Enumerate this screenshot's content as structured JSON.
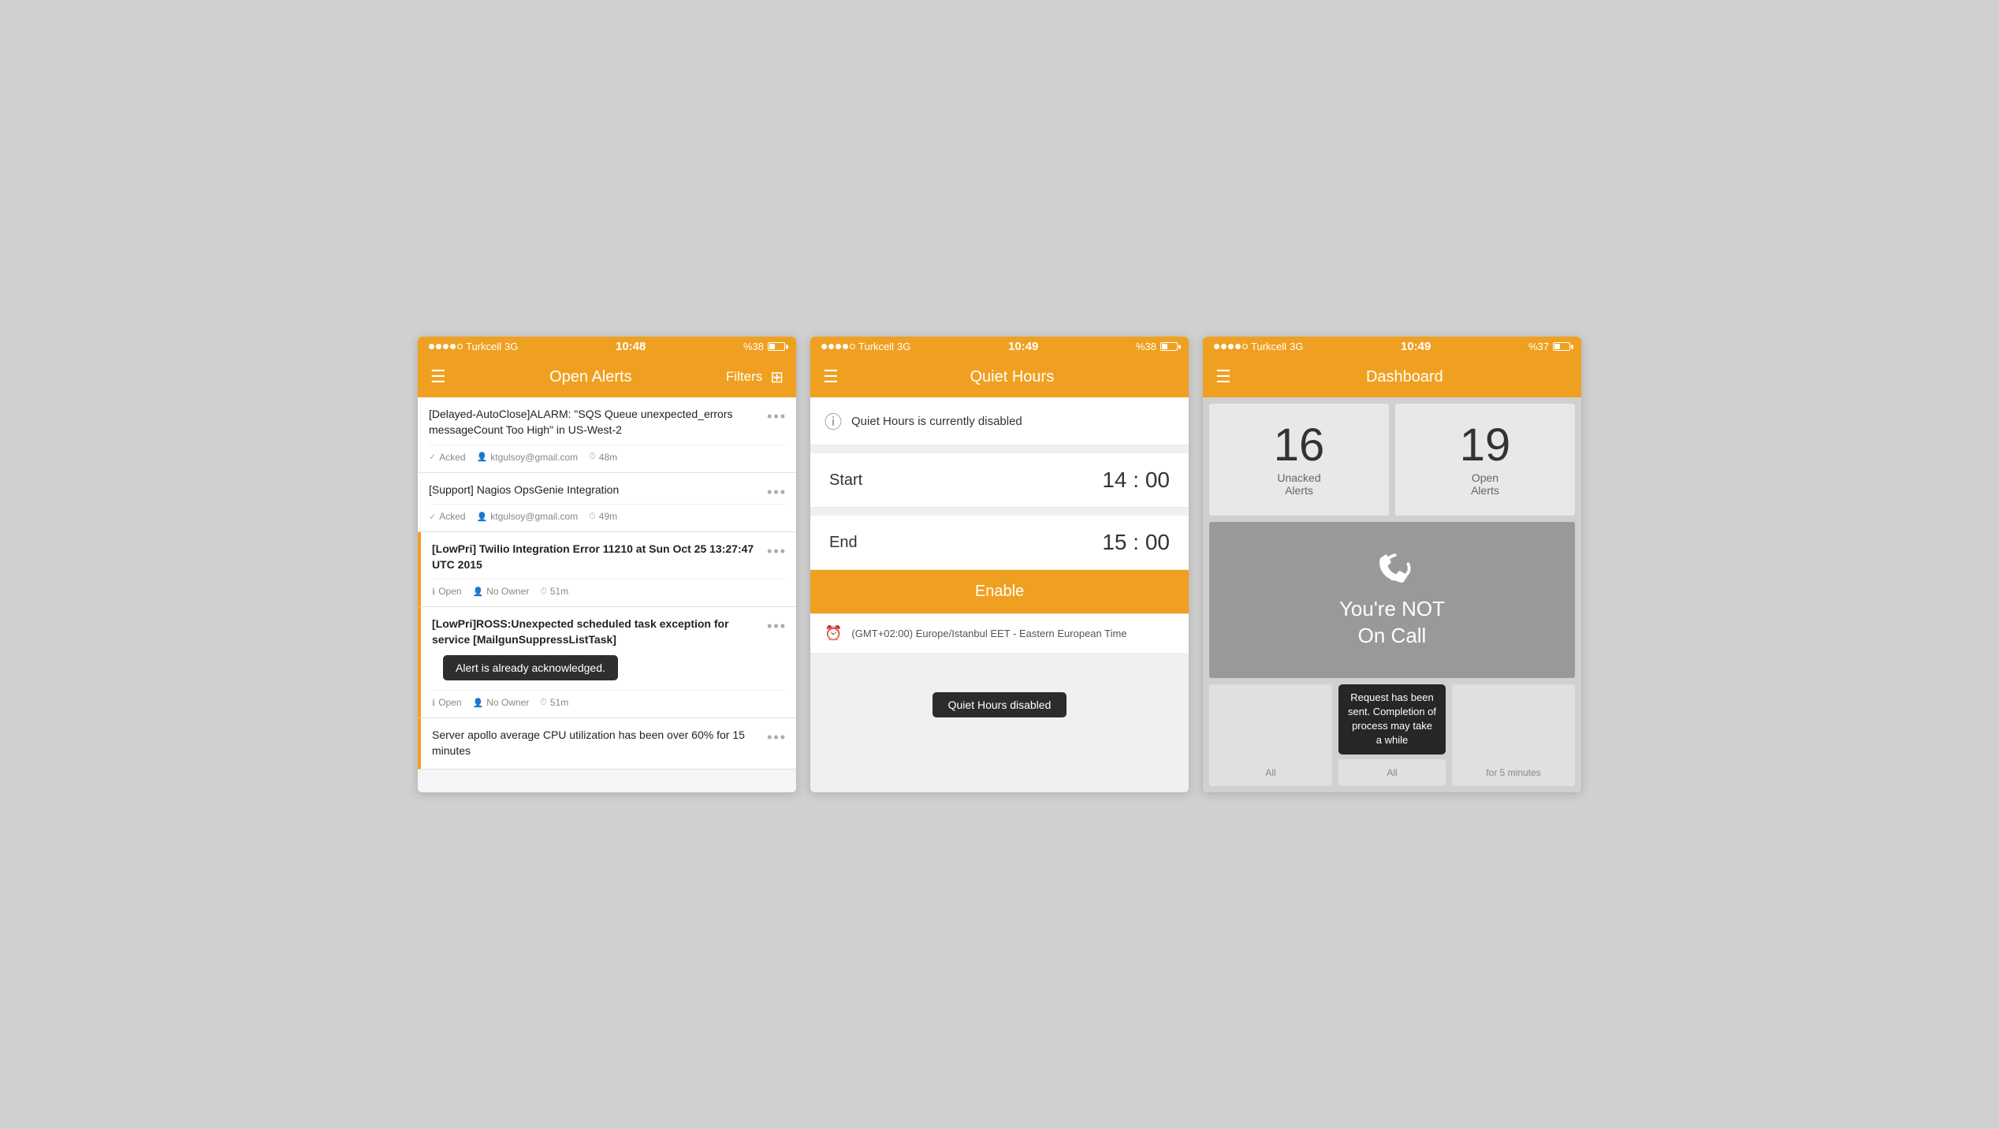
{
  "screen1": {
    "statusBar": {
      "carrier": "Turkcell",
      "network": "3G",
      "time": "10:48",
      "battery": "%38"
    },
    "navBar": {
      "title": "Open Alerts",
      "filterLabel": "Filters",
      "hamburgerIcon": "☰"
    },
    "alerts": [
      {
        "title": "[Delayed-AutoClose]ALARM: \"SQS Queue unexpected_errors messageCount Too High\" in US-West-2",
        "bold": false,
        "lowPri": false,
        "status": "Acked",
        "owner": "ktgulsoy@gmail.com",
        "time": "48m"
      },
      {
        "title": "[Support] Nagios OpsGenie Integration",
        "bold": false,
        "lowPri": false,
        "status": "Acked",
        "owner": "ktgulsoy@gmail.com",
        "time": "49m"
      },
      {
        "title": "[LowPri] Twilio Integration Error 11210 at Sun Oct 25 13:27:47 UTC 2015",
        "bold": true,
        "lowPri": true,
        "status": "Open",
        "owner": "No Owner",
        "time": "51m"
      },
      {
        "title": "[LowPri]ROSS:Unexpected scheduled task exception for service [MailgunSuppressListTask]",
        "bold": true,
        "lowPri": true,
        "status": "Open",
        "owner": "No Owner",
        "time": "51m",
        "toast": "Alert is already acknowledged."
      },
      {
        "title": "Server apollo average CPU utilization has been over 60% for 15 minutes",
        "bold": false,
        "lowPri": true,
        "status": null,
        "owner": null,
        "time": null
      }
    ]
  },
  "screen2": {
    "statusBar": {
      "carrier": "Turkcell",
      "network": "3G",
      "time": "10:49",
      "battery": "%38"
    },
    "navBar": {
      "title": "Quiet Hours",
      "hamburgerIcon": "☰"
    },
    "infoMessage": "Quiet Hours is currently disabled",
    "startLabel": "Start",
    "startTime": "14 : 00",
    "endLabel": "End",
    "endTime": "15 : 00",
    "enableButton": "Enable",
    "timezone": "(GMT+02:00) Europe/Istanbul EET - Eastern European Time",
    "toast": "Quiet Hours disabled"
  },
  "screen3": {
    "statusBar": {
      "carrier": "Turkcell",
      "network": "3G",
      "time": "10:49",
      "battery": "%37"
    },
    "navBar": {
      "title": "Dashboard",
      "hamburgerIcon": "☰"
    },
    "unackedCount": "16",
    "unackedLabel": "Unacked\nAlerts",
    "openCount": "19",
    "openLabel": "Open\nAlerts",
    "notOnCallLine1": "You're NOT",
    "notOnCallLine2": "On Call",
    "bottomCards": [
      {
        "label": "All"
      },
      {
        "label": "All"
      },
      {
        "label": "for 5 minutes"
      }
    ],
    "toast": "Request has been sent. Completion of process may take a while"
  }
}
